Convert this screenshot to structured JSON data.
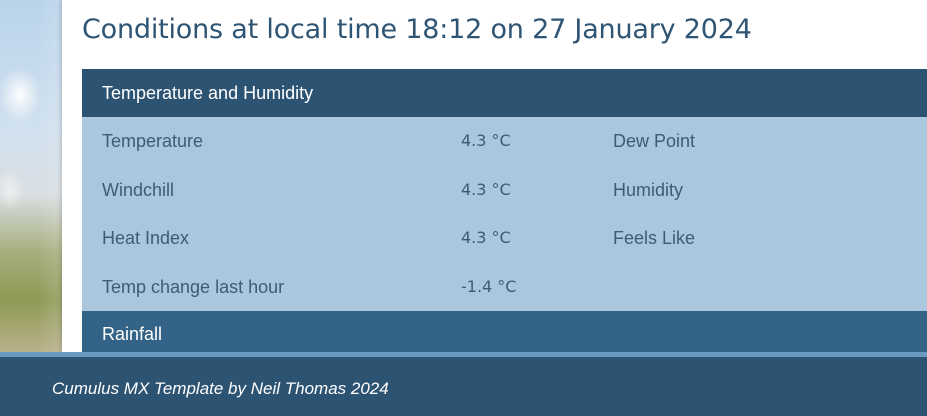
{
  "heading": "Conditions at local time 18:12 on 27 January 2024",
  "sections": {
    "temp_humidity": {
      "title": "Temperature and Humidity",
      "rows": [
        {
          "label": "Temperature",
          "value": "4.3 °C",
          "label2": "Dew Point"
        },
        {
          "label": "Windchill",
          "value": "4.3 °C",
          "label2": "Humidity"
        },
        {
          "label": "Heat Index",
          "value": "4.3 °C",
          "label2": "Feels Like"
        },
        {
          "label": "Temp change last hour",
          "value": "-1.4 °C",
          "label2": ""
        }
      ]
    },
    "rainfall": {
      "title": "Rainfall"
    }
  },
  "footer": {
    "text": "Cumulus MX Template by Neil Thomas 2024"
  },
  "colors": {
    "header_bg": "#2d5373",
    "row_bg": "#abc7de",
    "title_text": "#2f5575",
    "rainfall_bg": "#336386",
    "footer_accent": "#6c99bf"
  }
}
